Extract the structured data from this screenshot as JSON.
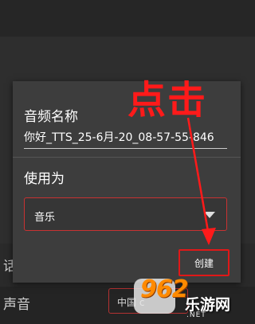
{
  "dialog": {
    "name_label": "音频名称",
    "name_value": "你好_TTS_25-6月-20_08-57-55-846",
    "use_as_label": "使用为",
    "use_as_value": "音乐",
    "create_button": "创建"
  },
  "background": {
    "row1_label": "话",
    "row2_label": "声音",
    "row2_value": "中国 c"
  },
  "annotation": {
    "text": "点击",
    "color": "#ff1a1a"
  },
  "watermark": {
    "number": "962",
    "site": "乐游网",
    "domain": ".NET"
  },
  "colors": {
    "dialog_bg": "#3d3d3d",
    "accent_red": "#c83232"
  },
  "icons": {
    "dropdown": "caret-down-icon",
    "arrow": "arrow-down-icon"
  }
}
